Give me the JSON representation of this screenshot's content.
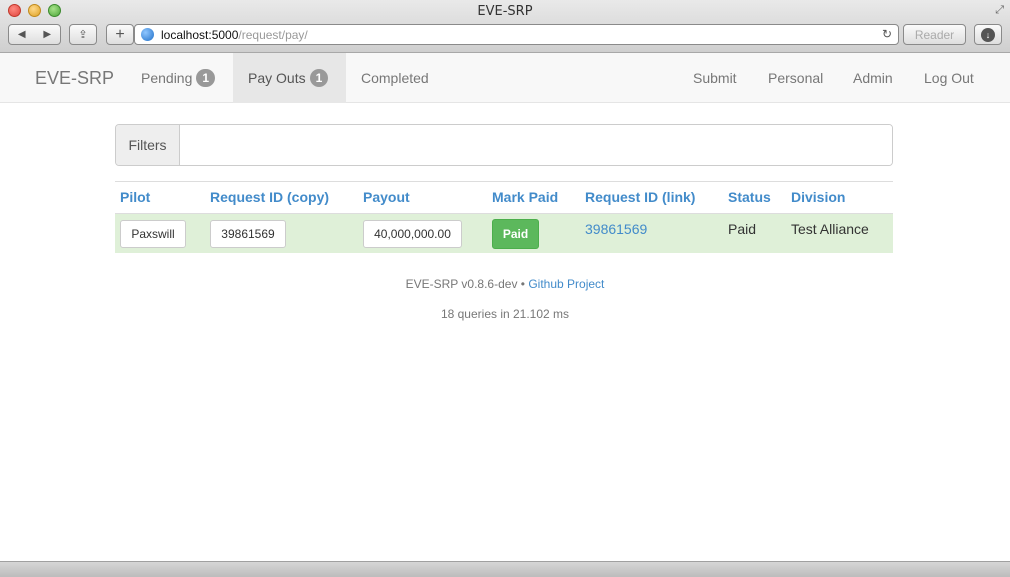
{
  "window": {
    "title": "EVE-SRP",
    "url_host": "localhost:5000",
    "url_path": "/request/pay/",
    "reader_label": "Reader"
  },
  "navbar": {
    "brand": "EVE-SRP",
    "pending_label": "Pending",
    "pending_count": "1",
    "payouts_label": "Pay Outs",
    "payouts_count": "1",
    "completed_label": "Completed",
    "submit_label": "Submit",
    "personal_label": "Personal",
    "admin_label": "Admin",
    "logout_label": "Log Out"
  },
  "filters": {
    "label": "Filters",
    "value": ""
  },
  "table": {
    "headers": {
      "pilot": "Pilot",
      "request_copy": "Request ID (copy)",
      "payout": "Payout",
      "mark_paid": "Mark Paid",
      "request_link": "Request ID (link)",
      "status": "Status",
      "division": "Division"
    },
    "rows": [
      {
        "pilot": "Paxswill",
        "request_id": "39861569",
        "payout": "40,000,000.00",
        "mark_paid": "Paid",
        "request_link": "39861569",
        "status": "Paid",
        "division": "Test Alliance"
      }
    ]
  },
  "footer": {
    "version": "EVE-SRP v0.8.6-dev",
    "separator": "•",
    "github_label": "Github Project",
    "queries": "18 queries in 21.102 ms"
  },
  "colors": {
    "link": "#428bca",
    "row_success": "#dff0d8",
    "paid_button": "#5cb85c",
    "badge": "#999999"
  }
}
